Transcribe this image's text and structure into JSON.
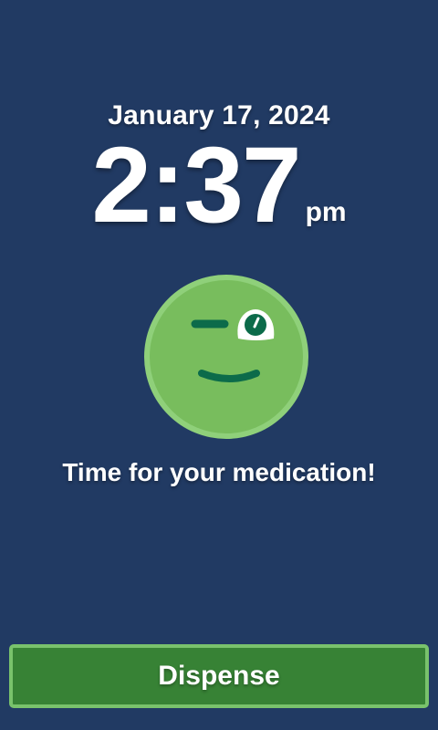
{
  "datetime": {
    "date": "January 17, 2024",
    "time": "2:37",
    "period": "pm"
  },
  "status": {
    "mascot": "winking-face-icon",
    "message": "Time for your medication!"
  },
  "actions": {
    "dispense_label": "Dispense"
  },
  "colors": {
    "background": "#213a63",
    "face_fill": "#78bd5d",
    "face_rim": "#8fd07a",
    "face_features": "#0c6b4a",
    "button_fill": "#378235",
    "button_border": "#79c26c"
  }
}
